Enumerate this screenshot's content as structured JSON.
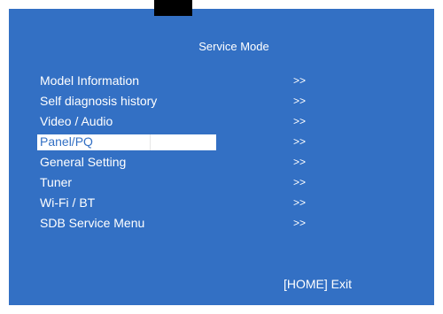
{
  "screen": {
    "title": "Service Mode",
    "background_color": "#3370c4",
    "selected_index": 3,
    "menu": [
      {
        "label": "Model Information",
        "arrow": ">>"
      },
      {
        "label": "Self diagnosis history",
        "arrow": ">>"
      },
      {
        "label": "Video / Audio",
        "arrow": ">>"
      },
      {
        "label": "Panel/PQ",
        "arrow": ">>"
      },
      {
        "label": "General Setting",
        "arrow": ">>"
      },
      {
        "label": "Tuner",
        "arrow": ">>"
      },
      {
        "label": "Wi-Fi / BT",
        "arrow": ">>"
      },
      {
        "label": "SDB Service Menu",
        "arrow": ">>"
      }
    ],
    "exit_hint": "[HOME] Exit"
  }
}
